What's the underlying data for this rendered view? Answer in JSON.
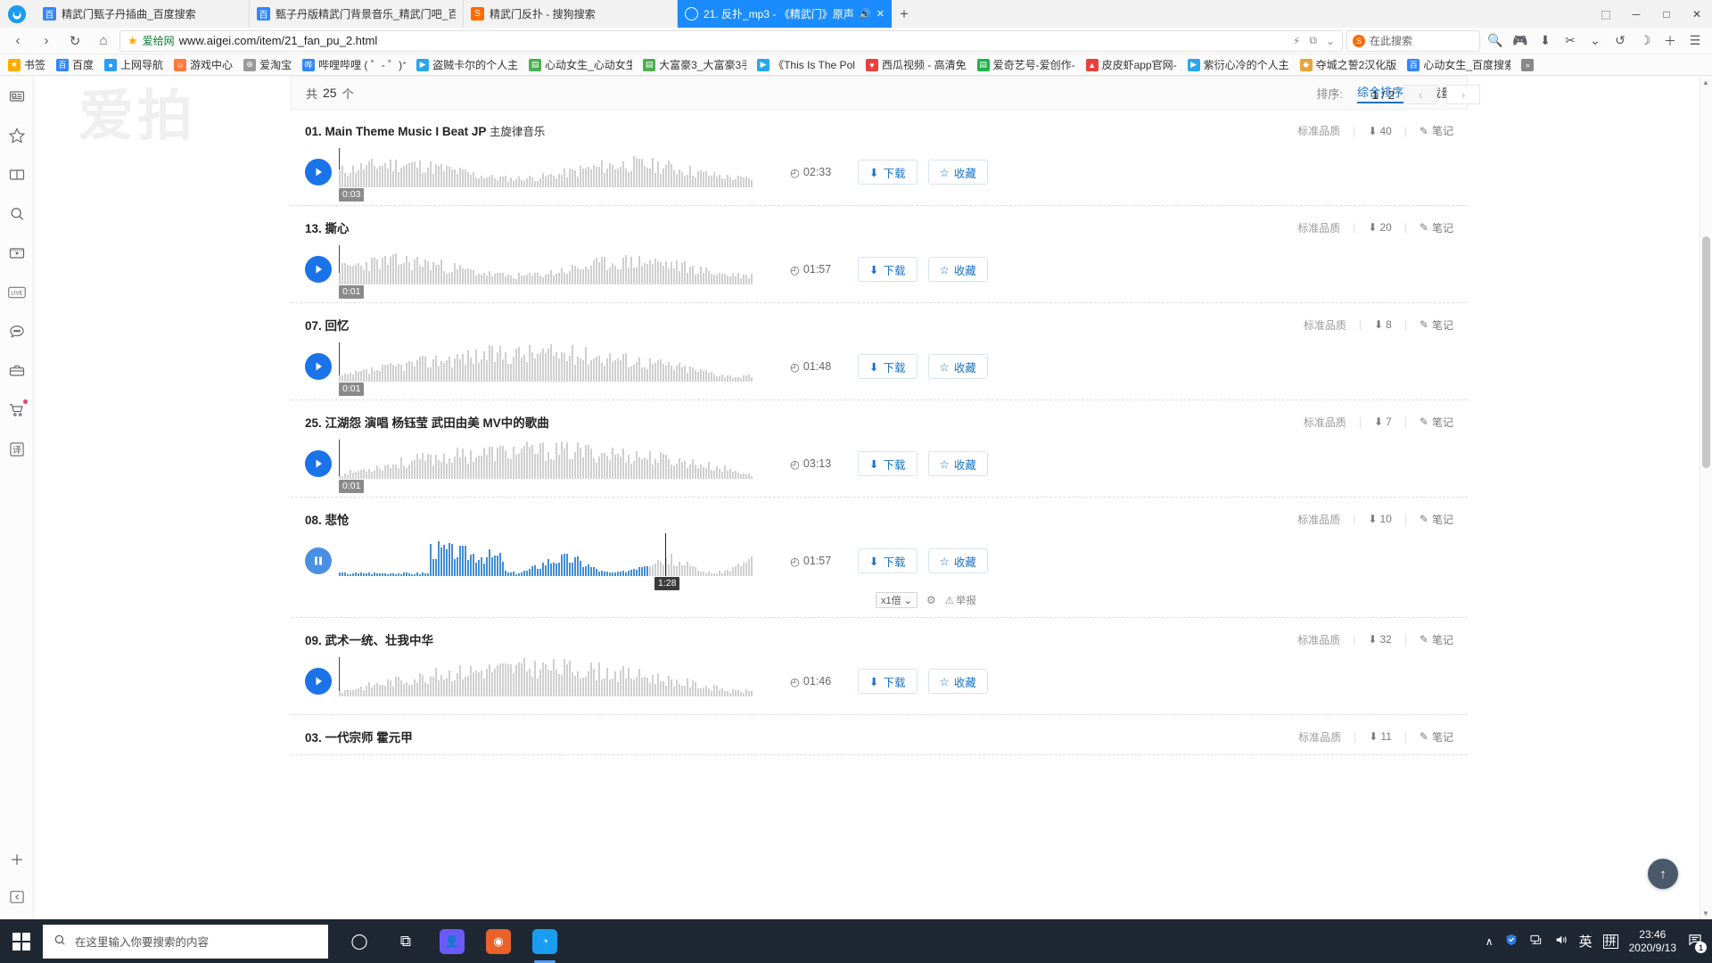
{
  "browser": {
    "tabs": [
      {
        "title": "精武门甄子丹插曲_百度搜索",
        "favicon": "baidu-icon",
        "color": "#3385ff",
        "glyph": "百",
        "active": false
      },
      {
        "title": "甄子丹版精武门背景音乐_精武门吧_百",
        "favicon": "baidu-icon",
        "color": "#3385ff",
        "glyph": "百",
        "active": false
      },
      {
        "title": "精武门反扑 - 搜狗搜索",
        "favicon": "sogou-icon",
        "color": "#ff6a00",
        "glyph": "S",
        "active": false
      },
      {
        "title": "21. 反扑_mp3 - 《精武门》原声",
        "favicon": "aigei-icon",
        "color": "#ffffff",
        "glyph": "C",
        "active": true
      }
    ],
    "newtab_label": "+",
    "window_controls": {
      "minimize": "─",
      "maximize": "□",
      "close": "✕",
      "extra": "⬚"
    },
    "nav": {
      "back": "‹",
      "forward": "›",
      "reload": "↻",
      "home": "⌂"
    },
    "address": {
      "star": "★",
      "sitename": "爱给网",
      "url": "www.aigei.com/item/21_fan_pu_2.html",
      "lightning": "⚡",
      "share": "⧉",
      "chevron": "⌄"
    },
    "search": {
      "placeholder": "在此搜索",
      "engine_glyph": "S"
    },
    "toolbar_icons": [
      {
        "name": "search-icon",
        "glyph": "🔍"
      },
      {
        "name": "gamepad-icon",
        "glyph": "🎮"
      },
      {
        "name": "download-icon",
        "glyph": "⬇"
      },
      {
        "name": "scissors-icon",
        "glyph": "✂"
      },
      {
        "name": "chevron-down-icon",
        "glyph": "⌄"
      },
      {
        "name": "history-icon",
        "glyph": "↺"
      },
      {
        "name": "moon-icon",
        "glyph": "☽"
      },
      {
        "name": "add-icon",
        "glyph": "＋"
      },
      {
        "name": "menu-icon",
        "glyph": "☰"
      }
    ],
    "bookmarks": [
      {
        "label": "书签",
        "glyph": "★",
        "color": "#ffaa00"
      },
      {
        "label": "百度",
        "glyph": "百",
        "color": "#3385ff"
      },
      {
        "label": "上网导航",
        "glyph": "●",
        "color": "#2b9bf4"
      },
      {
        "label": "游戏中心",
        "glyph": "☺",
        "color": "#ff7a3d"
      },
      {
        "label": "爱淘宝",
        "glyph": "⊕",
        "color": "#9a9a9a"
      },
      {
        "label": "哔哩哔哩 ( ゜- ゜)つ",
        "glyph": "哔",
        "color": "#3385ff"
      },
      {
        "label": "盗贼卡尔的个人主",
        "glyph": "▶",
        "color": "#29a6f0"
      },
      {
        "label": "心动女生_心动女生",
        "glyph": "▤",
        "color": "#4caf50"
      },
      {
        "label": "大富豪3_大富豪3手",
        "glyph": "▤",
        "color": "#4caf50"
      },
      {
        "label": "《This Is The Pol",
        "glyph": "▶",
        "color": "#29a6f0"
      },
      {
        "label": "西瓜视频 - 高清免",
        "glyph": "♥",
        "color": "#e8413c"
      },
      {
        "label": "爱奇艺号-爱创作-",
        "glyph": "▤",
        "color": "#22b14c"
      },
      {
        "label": "皮皮虾app官网-",
        "glyph": "▲",
        "color": "#e8413c"
      },
      {
        "label": "紫衍心冷的个人主",
        "glyph": "▶",
        "color": "#29a6f0"
      },
      {
        "label": "夺城之誓2汉化版",
        "glyph": "◆",
        "color": "#e8a33c"
      },
      {
        "label": "心动女生_百度搜索",
        "glyph": "百",
        "color": "#3385ff"
      },
      {
        "label": "",
        "glyph": "»",
        "color": "#888888"
      }
    ]
  },
  "sidebar": {
    "items": [
      {
        "name": "news-icon",
        "label": "资讯"
      },
      {
        "name": "favorites-star-icon",
        "label": "收藏"
      },
      {
        "name": "book-icon",
        "label": "小说"
      },
      {
        "name": "search-icon",
        "label": "搜索"
      },
      {
        "name": "video-icon",
        "label": "视频"
      },
      {
        "name": "live-icon",
        "label": "LIVE"
      },
      {
        "name": "chat-icon",
        "label": "聊天"
      },
      {
        "name": "briefcase-icon",
        "label": "工具箱"
      },
      {
        "name": "cart-icon",
        "label": "购物车"
      },
      {
        "name": "translate-icon",
        "label": "译"
      }
    ],
    "bottom": [
      {
        "name": "add-icon",
        "label": "＋"
      },
      {
        "name": "collapse-icon",
        "label": "«"
      }
    ]
  },
  "page": {
    "watermark": "爱拍",
    "toolbar": {
      "count_prefix": "共",
      "count": "25",
      "count_suffix": "个",
      "sort_label": "排序:",
      "sort_options": [
        {
          "label": "综合排序",
          "active": true
        },
        {
          "label": "下载量",
          "active": false
        }
      ]
    },
    "pagination": {
      "current": "1",
      "separator": "/",
      "total": "2",
      "prev_glyph": "‹",
      "next_glyph": "›"
    },
    "labels": {
      "quality": "标准品质",
      "note": "笔记",
      "download": "下载",
      "favorite": "收藏",
      "report": "举报",
      "speed": "x1倍",
      "clock_glyph": "◴",
      "download_glyph": "⬇",
      "note_glyph": "✎",
      "star_glyph": "☆",
      "gear_glyph": "⚙",
      "warn_glyph": "⚠"
    },
    "tracks": [
      {
        "index": "01.",
        "title": "Main Theme Music I Beat JP",
        "subtitle": "主旋律音乐",
        "quality": "标准品质",
        "downloads": "40",
        "duration": "02:33",
        "start_time": "0:03",
        "state": "idle",
        "progress": 0,
        "seed": 11
      },
      {
        "index": "13.",
        "title": "撕心",
        "subtitle": "",
        "quality": "标准品质",
        "downloads": "20",
        "duration": "01:57",
        "start_time": "0:01",
        "state": "idle",
        "progress": 0,
        "seed": 23
      },
      {
        "index": "07.",
        "title": "回忆",
        "subtitle": "",
        "quality": "标准品质",
        "downloads": "8",
        "duration": "01:48",
        "start_time": "0:01",
        "state": "idle",
        "progress": 0,
        "seed": 37
      },
      {
        "index": "25.",
        "title": "江湖怨 演唱 杨钰莹 武田由美 MV中的歌曲",
        "subtitle": "",
        "quality": "标准品质",
        "downloads": "7",
        "duration": "03:13",
        "start_time": "0:01",
        "state": "idle",
        "progress": 0,
        "seed": 53
      },
      {
        "index": "08.",
        "title": "悲怆",
        "subtitle": "",
        "quality": "标准品质",
        "downloads": "10",
        "duration": "01:57",
        "start_time": "",
        "playhead_time": "1:28",
        "state": "playing",
        "progress": 0.75,
        "seed": 67
      },
      {
        "index": "09.",
        "title": "武术一统、壮我中华",
        "subtitle": "",
        "quality": "标准品质",
        "downloads": "32",
        "duration": "01:46",
        "start_time": "",
        "state": "idle",
        "progress": 0,
        "seed": 83
      },
      {
        "index": "03.",
        "title": "一代宗师 霍元甲",
        "subtitle": "",
        "quality": "标准品质",
        "downloads": "11",
        "duration": "",
        "start_time": "",
        "state": "partial",
        "progress": 0,
        "seed": 97
      }
    ],
    "back_to_top_glyph": "↑"
  },
  "taskbar": {
    "start_glyph": "⊞",
    "search_placeholder": "在这里输入你要搜索的内容",
    "search_icon": "🔍",
    "icons": [
      {
        "name": "cortana-icon",
        "glyph": "◯",
        "color": "transparent"
      },
      {
        "name": "task-view-icon",
        "glyph": "⧉",
        "color": "transparent"
      },
      {
        "name": "app-store-icon",
        "glyph": "👤",
        "color": "#6a5af9"
      },
      {
        "name": "firefox-icon",
        "glyph": "◉",
        "color": "#e8622a"
      },
      {
        "name": "qq-browser-icon",
        "glyph": "◔",
        "color": "#1a9cf0"
      }
    ],
    "tray": {
      "chevron": "∧",
      "shield": "▼",
      "network": "🖥",
      "volume": "🔊",
      "ime_lang": "英",
      "ime_mode": "拼",
      "time": "23:46",
      "date": "2020/9/13",
      "notification_glyph": "💬",
      "notification_count": "1"
    }
  }
}
